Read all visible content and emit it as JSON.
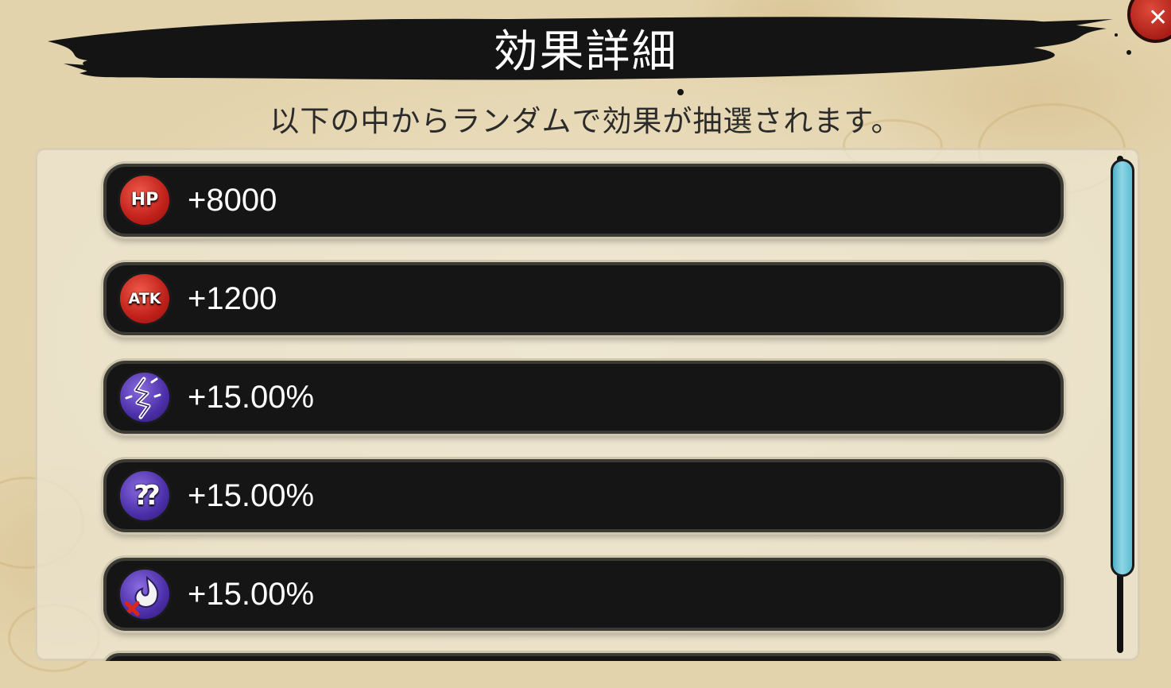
{
  "dialog": {
    "title": "効果詳細",
    "subtitle": "以下の中からランダムで効果が抽選されます。",
    "close_icon": "close-icon"
  },
  "effects": [
    {
      "icon": "hp-icon",
      "icon_text": "HP",
      "value": "+8000",
      "color": "#c0201a"
    },
    {
      "icon": "atk-icon",
      "icon_text": "ATK",
      "value": "+1200",
      "color": "#c0201a"
    },
    {
      "icon": "lightning-crack-icon",
      "icon_text": "",
      "value": "+15.00%",
      "color": "#4b2fa8"
    },
    {
      "icon": "question-marks-icon",
      "icon_text": "",
      "value": "+15.00%",
      "color": "#4b2fa8"
    },
    {
      "icon": "flame-cancel-icon",
      "icon_text": "",
      "value": "+15.00%",
      "color": "#4b2fa8"
    }
  ],
  "scrollbar": {
    "position": 0.0,
    "visible_fraction": 0.84,
    "color": "#7ccbe0"
  }
}
